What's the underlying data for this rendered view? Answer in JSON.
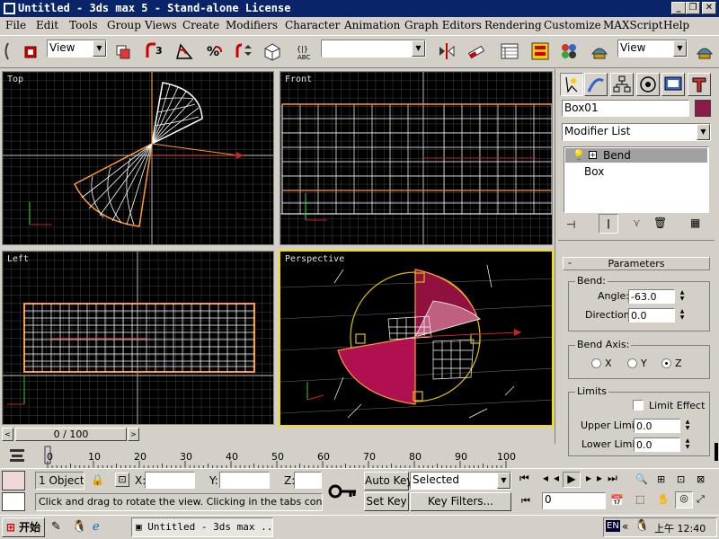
{
  "window": {
    "title": "Untitled - 3ds max 5 - Stand-alone License",
    "minimize": "_",
    "restore": "❐",
    "close": "✕"
  },
  "menu": [
    "File",
    "Edit",
    "Tools",
    "Group",
    "Views",
    "Create",
    "Modifiers",
    "Character",
    "Animation",
    "Graph Editors",
    "Rendering",
    "Customize",
    "MAXScript",
    "Help"
  ],
  "toolbar": {
    "ref_coord": "View",
    "named_selection": "",
    "view_combo": "View"
  },
  "viewports": {
    "top": "Top",
    "front": "Front",
    "left": "Left",
    "perspective": "Perspective"
  },
  "command_panel": {
    "object_name": "Box01",
    "object_color": "#8b1a4a",
    "modifier_list": "Modifier List",
    "stack": [
      {
        "label": "Bend",
        "selected": true
      },
      {
        "label": "Box",
        "selected": false
      }
    ],
    "rollout_title": "Parameters",
    "bend_group": "Bend:",
    "angle_label": "Angle:",
    "angle_value": "-63.0",
    "direction_label": "Direction:",
    "direction_value": "0.0",
    "axis_group": "Bend Axis:",
    "axis_x": "X",
    "axis_y": "Y",
    "axis_z": "Z",
    "selected_axis": "Z",
    "limits_group": "Limits",
    "limit_effect": "Limit Effect",
    "upper_label": "Upper Limit:",
    "upper_value": "0.0",
    "lower_label": "Lower Limit:",
    "lower_value": "0.0"
  },
  "timeline": {
    "slider": "0 / 100",
    "ticks": [
      "0",
      "10",
      "20",
      "30",
      "40",
      "50",
      "60",
      "70",
      "80",
      "90",
      "100"
    ]
  },
  "status": {
    "selection": "1 Object S",
    "x_label": "X:",
    "y_label": "Y:",
    "z_label": "Z:",
    "prompt": "Click and drag to rotate the view.  Clicking in the tabs constrains the",
    "auto_key": "Auto Key",
    "set_key": "Set Key",
    "key_mode": "Selected",
    "key_filters": "Key Filters...",
    "frame": "0"
  },
  "taskbar": {
    "start": "开始",
    "task": "Untitled - 3ds max ...",
    "lang": "EN",
    "clock": "上午 12:40"
  }
}
